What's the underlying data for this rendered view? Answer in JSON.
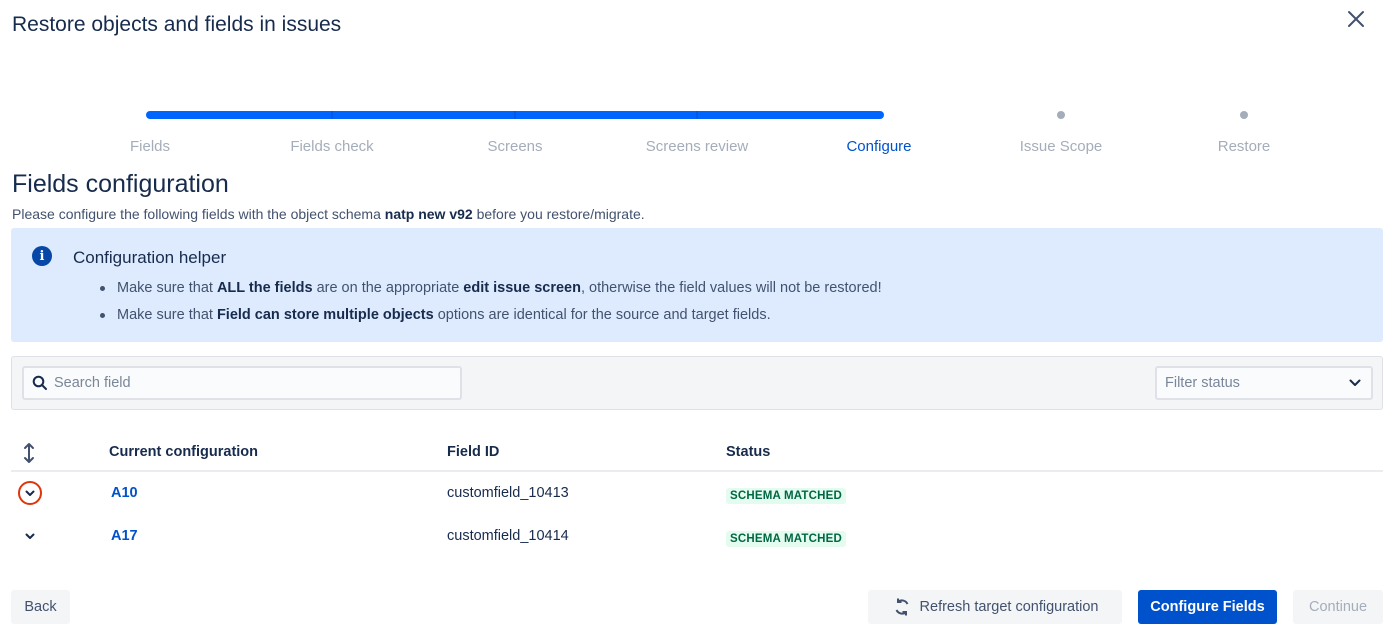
{
  "dialog": {
    "title": "Restore objects and fields in issues"
  },
  "stepper": {
    "steps": [
      {
        "label": "Fields",
        "state": "done"
      },
      {
        "label": "Fields check",
        "state": "done"
      },
      {
        "label": "Screens",
        "state": "done"
      },
      {
        "label": "Screens review",
        "state": "done"
      },
      {
        "label": "Configure",
        "state": "active"
      },
      {
        "label": "Issue Scope",
        "state": "pending"
      },
      {
        "label": "Restore",
        "state": "pending"
      }
    ]
  },
  "section": {
    "title": "Fields configuration",
    "subtitle_pre": "Please configure the following fields with the object schema ",
    "schema_name": "natp new v92",
    "subtitle_post": " before you restore/migrate."
  },
  "helper": {
    "icon": "info-icon",
    "title": "Configuration helper",
    "items": [
      {
        "pre": "Make sure that ",
        "bold1": "ALL the fields",
        "mid": " are on the appropriate ",
        "bold2": "edit issue screen",
        "post": ", otherwise the field values will not be restored!"
      },
      {
        "pre": "Make sure that ",
        "bold1": "Field can store multiple objects",
        "post": " options are identical for the source and target fields."
      }
    ]
  },
  "filters": {
    "search_placeholder": "Search field",
    "search_value": "",
    "status_placeholder": "Filter status"
  },
  "table": {
    "headers": {
      "config": "Current configuration",
      "field_id": "Field ID",
      "status": "Status"
    },
    "rows": [
      {
        "name": "A10",
        "field_id": "customfield_10413",
        "status": "SCHEMA MATCHED"
      },
      {
        "name": "A17",
        "field_id": "customfield_10414",
        "status": "SCHEMA MATCHED"
      }
    ]
  },
  "footer": {
    "back": "Back",
    "refresh": "Refresh target configuration",
    "configure": "Configure Fields",
    "continue": "Continue"
  },
  "colors": {
    "primary": "#0052cc",
    "progress": "#0065ff",
    "helper_bg": "#deebff",
    "lozenge_bg": "#e3fcef",
    "lozenge_text": "#006644",
    "highlight_ring": "#de350b"
  }
}
